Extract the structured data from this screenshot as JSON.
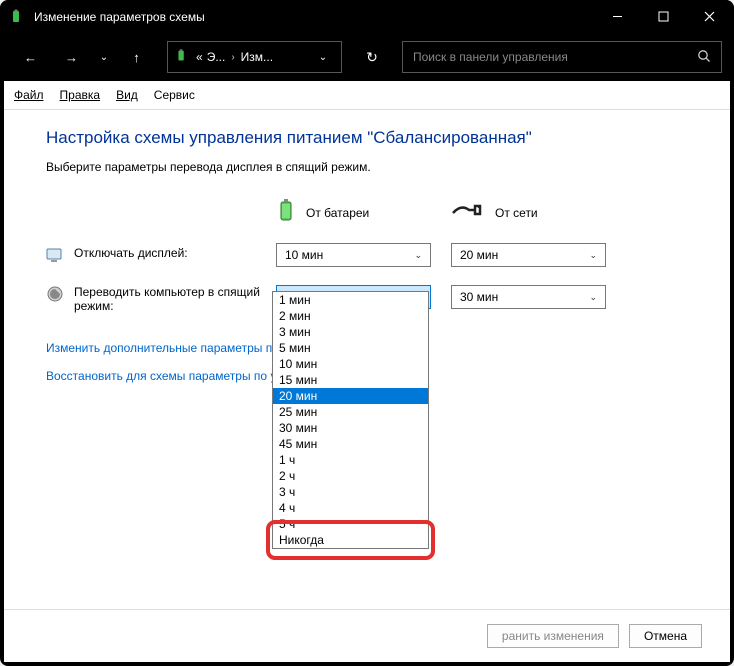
{
  "window": {
    "title": "Изменение параметров схемы"
  },
  "breadcrumb": {
    "prefix": "«",
    "seg1": "Э...",
    "seg2": "Изм..."
  },
  "search": {
    "placeholder": "Поиск в панели управления"
  },
  "menus": {
    "file": "Файл",
    "edit": "Правка",
    "view": "Вид",
    "tools": "Сервис"
  },
  "page": {
    "title": "Настройка схемы управления питанием \"Сбалансированная\"",
    "subtitle": "Выберите параметры перевода дисплея в спящий режим."
  },
  "columns": {
    "battery": "От батареи",
    "plugged": "От сети"
  },
  "rows": {
    "display_off": {
      "label": "Отключать дисплей:",
      "battery": "10 мин",
      "plugged": "20 мин"
    },
    "sleep": {
      "label": "Переводить компьютер в спящий режим:",
      "battery": "20 мин",
      "plugged": "30 мин"
    }
  },
  "links": {
    "advanced": "Изменить дополнительные параметры пи",
    "restore": "Восстановить для схемы параметры по у"
  },
  "buttons": {
    "save": "ранить изменения",
    "cancel": "Отмена"
  },
  "dropdown_options": [
    "1 мин",
    "2 мин",
    "3 мин",
    "5 мин",
    "10 мин",
    "15 мин",
    "20 мин",
    "25 мин",
    "30 мин",
    "45 мин",
    "1 ч",
    "2 ч",
    "3 ч",
    "4 ч",
    "5 ч",
    "Никогда"
  ],
  "dropdown_selected_index": 6
}
